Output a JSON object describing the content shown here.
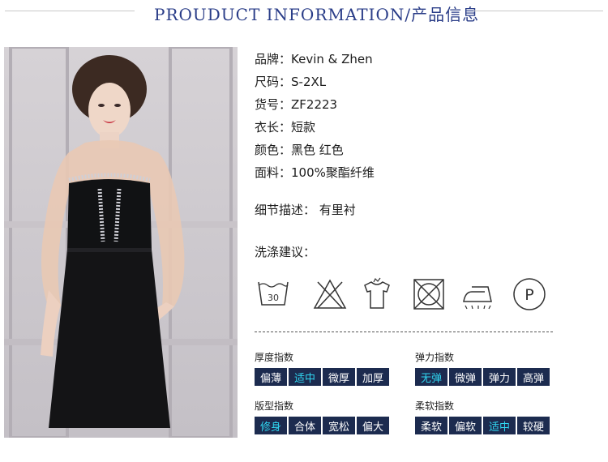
{
  "header": {
    "title": "PROUDUCT INFORMATION/产品信息"
  },
  "photo": {
    "alt": ""
  },
  "specs": [
    {
      "label": "品牌：",
      "value": "Kevin & Zhen"
    },
    {
      "label": "尺码：",
      "value": "S-2XL"
    },
    {
      "label": "货号：",
      "value": "ZF2223"
    },
    {
      "label": "衣长：",
      "value": "短款"
    },
    {
      "label": "颜色：",
      "value": "黑色 红色"
    },
    {
      "label": "面料：",
      "value": "100%聚酯纤维"
    }
  ],
  "detail": {
    "label": "细节描述：",
    "value": "有里衬"
  },
  "wash": {
    "label": "洗涤建议：",
    "icons": [
      "wash-30-icon",
      "no-bleach-icon",
      "hand-wash-icon",
      "no-tumble-dry-icon",
      "iron-icon",
      "dry-clean-p-icon"
    ],
    "wash_temp": "30",
    "p_letter": "P"
  },
  "indices": {
    "thickness": {
      "title": "厚度指数",
      "options": [
        "偏薄",
        "适中",
        "微厚",
        "加厚"
      ],
      "selected": 1
    },
    "elasticity": {
      "title": "弹力指数",
      "options": [
        "无弹",
        "微弹",
        "弹力",
        "高弹"
      ],
      "selected": 0
    },
    "fit": {
      "title": "版型指数",
      "options": [
        "修身",
        "合体",
        "宽松",
        "偏大"
      ],
      "selected": 0
    },
    "softness": {
      "title": "柔软指数",
      "options": [
        "柔软",
        "偏软",
        "适中",
        "较硬"
      ],
      "selected": 2
    }
  },
  "colors": {
    "title": "#2a3d88",
    "chip_bg": "#1c2b4f",
    "chip_selected_text": "#30d6f0"
  }
}
